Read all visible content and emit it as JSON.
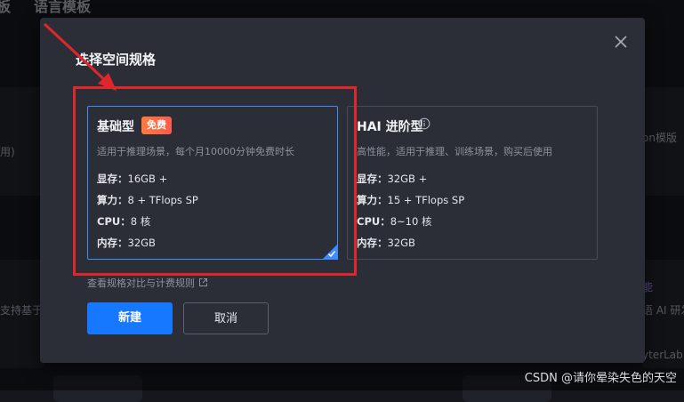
{
  "background": {
    "tab_left": "板",
    "tab_language": "语言模板",
    "left_card_text": "用)",
    "left_card_text2": "支持基于",
    "right_card_text": "on模版",
    "right_card_badge": "能",
    "right_card_text2": "语 AI 研发",
    "right_card_text3": "yterLab"
  },
  "dialog": {
    "title": "选择空间规格",
    "cards": [
      {
        "name": "基础型",
        "badge": "免费",
        "description": "适用于推理场景，每个月10000分钟免费时长",
        "specs": [
          {
            "key": "显存：",
            "value": "16GB +"
          },
          {
            "key": "算力：",
            "value": "8 + TFlops SP"
          },
          {
            "key": "CPU：",
            "value": "8 核"
          },
          {
            "key": "内存：",
            "value": "32GB"
          }
        ],
        "selected": true
      },
      {
        "name": "HAI 进阶型",
        "description": "高性能，适用于推理、训练场景，购买后使用",
        "specs": [
          {
            "key": "显存：",
            "value": "32GB +"
          },
          {
            "key": "算力：",
            "value": "15 + TFlops SP"
          },
          {
            "key": "CPU：",
            "value": "8~10 核"
          },
          {
            "key": "内存：",
            "value": "32GB"
          }
        ],
        "selected": false
      }
    ],
    "compare_link": "查看规格对比与计费规则",
    "primary_button": "新建",
    "cancel_button": "取消"
  },
  "watermark": "CSDN @请你晕染失色的天空",
  "colors": {
    "accent": "#1677ff",
    "annotation": "#e0262b",
    "badge": "#ff6a42"
  }
}
